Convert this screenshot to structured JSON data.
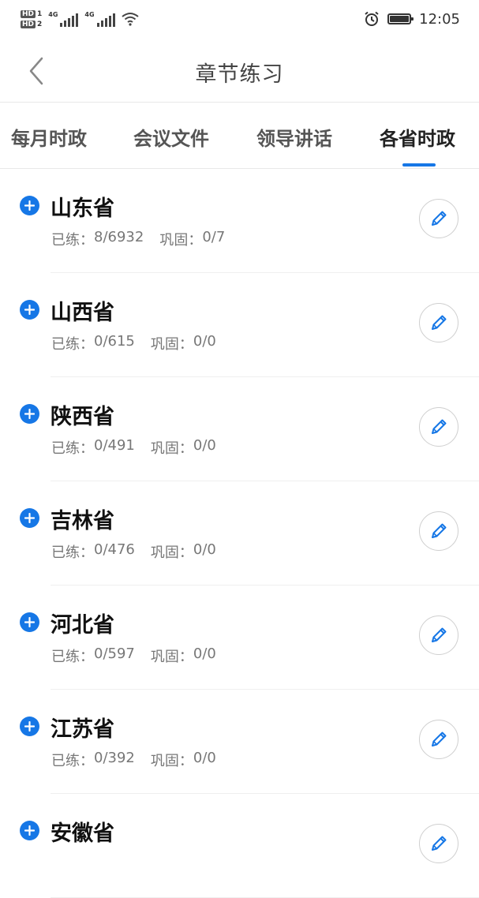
{
  "status_bar": {
    "hd1": "HD",
    "hd1_sub": "1",
    "hd2": "HD",
    "hd2_sub": "2",
    "net1": "4G",
    "net2": "4G",
    "time": "12:05"
  },
  "header": {
    "title": "章节练习"
  },
  "tabs": [
    {
      "label": "每月时政"
    },
    {
      "label": "会议文件"
    },
    {
      "label": "领导讲话"
    },
    {
      "label": "各省时政",
      "active": true
    }
  ],
  "list": {
    "practiced_label": "已练：",
    "consolidated_label": "巩固：",
    "items": [
      {
        "name": "山东省",
        "practiced": "8/6932",
        "consolidated": "0/7"
      },
      {
        "name": "山西省",
        "practiced": "0/615",
        "consolidated": "0/0"
      },
      {
        "name": "陕西省",
        "practiced": "0/491",
        "consolidated": "0/0"
      },
      {
        "name": "吉林省",
        "practiced": "0/476",
        "consolidated": "0/0"
      },
      {
        "name": "河北省",
        "practiced": "0/597",
        "consolidated": "0/0"
      },
      {
        "name": "江苏省",
        "practiced": "0/392",
        "consolidated": "0/0"
      },
      {
        "name": "安徽省",
        "practiced": "",
        "consolidated": ""
      }
    ]
  },
  "colors": {
    "accent": "#1677e6",
    "text": "#111111",
    "muted": "#777777"
  }
}
